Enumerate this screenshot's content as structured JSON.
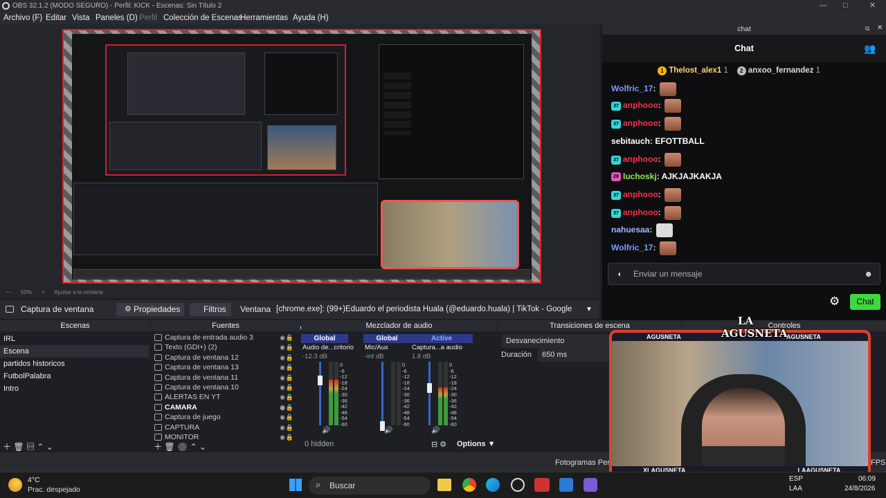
{
  "window": {
    "title": "OBS 32.1.2 (MODO SEGURO) - Perfil: KICK - Escenas: Sin Título 2",
    "controls": [
      "—",
      "□",
      "✕"
    ]
  },
  "menu": [
    "Archivo (F)",
    "Editar",
    "Vista",
    "Paneles (D)",
    "Perfil",
    "Colección de Escenas",
    "Herramientas",
    "Ayuda (H)"
  ],
  "preview": {
    "zoom": "50%",
    "fit_label": "Ajustar a la ventana"
  },
  "context_bar": {
    "source_name": "Captura de ventana",
    "properties": "Propiedades",
    "filters": "Filtros",
    "window_label": "Ventana",
    "window_value": "[chrome.exe]: (99+)Eduardo el periodista Huala (@eduardo.huala) | TikTok - Google Chrome"
  },
  "chat": {
    "dock_title": "chat",
    "header": "Chat",
    "pinned": [
      {
        "rank": "1",
        "user": "Thelost_alex1",
        "count": "1"
      },
      {
        "rank": "2",
        "user": "anxoo_fernandez",
        "count": "1"
      }
    ],
    "messages": [
      {
        "user": "Wolfric_17",
        "badge": "",
        "text": "",
        "color": "#7a9cff",
        "emote": true
      },
      {
        "user": "anphooo",
        "badge": "37",
        "text": "",
        "color": "#ff2a4a",
        "emote": true
      },
      {
        "user": "anphooo",
        "badge": "37",
        "text": "",
        "color": "#ff2a4a",
        "emote": true
      },
      {
        "user": "sebitauch",
        "badge": "",
        "text": "EFOTTBALL",
        "color": "#ffffff",
        "emote": false
      },
      {
        "user": "anphooo",
        "badge": "37",
        "text": "",
        "color": "#ff2a4a",
        "emote": true
      },
      {
        "user": "luchoskj",
        "badge": "28",
        "text": "AJKJAJKAKJA",
        "color": "#9ae64b",
        "emote": false
      },
      {
        "user": "anphooo",
        "badge": "37",
        "text": "",
        "color": "#ff2a4a",
        "emote": true
      },
      {
        "user": "anphooo",
        "badge": "37",
        "text": "",
        "color": "#ff2a4a",
        "emote": true
      },
      {
        "user": "nahuesaa",
        "badge": "",
        "text": "",
        "color": "#9ab8ff",
        "emote": true
      },
      {
        "user": "Wolfric_17",
        "badge": "",
        "text": "",
        "color": "#7a9cff",
        "emote": true
      }
    ],
    "input_placeholder": "Enviar un mensaje",
    "send_label": "Chat"
  },
  "docks": {
    "scenes": {
      "title": "Escenas",
      "items": [
        "IRL",
        "Escena",
        "partidos historicos",
        "FutbolPalabra",
        "Intro"
      ],
      "selected": 1
    },
    "sources": {
      "title": "Fuentes",
      "items": [
        "Captura de entrada audio 3",
        "Texto (GDI+) (2)",
        "Captura de ventana 12",
        "Captura de ventana 13",
        "Captura de ventana 11",
        "Captura de ventana 10",
        "ALERTAS EN YT",
        "CAMARA",
        "Captura de juego",
        "CAPTURA",
        "MONITOR"
      ]
    },
    "mixer": {
      "title": "Mezclador de audio",
      "channels": [
        {
          "tag": "Global",
          "name": "Audio de...critorio",
          "db": "-12.3 dB"
        },
        {
          "tag": "Global",
          "name": "Mic/Aux",
          "db": "-inf dB"
        },
        {
          "tag": "Active",
          "name": "Captura...a audio",
          "db": "1.8 dB"
        }
      ],
      "scale": [
        "0",
        "-6",
        "-12",
        "-18",
        "-24",
        "-30",
        "-36",
        "-42",
        "-48",
        "-54",
        "-60"
      ],
      "hidden": "0 hidden",
      "options": "Options"
    },
    "transitions": {
      "title": "Transiciones de escena",
      "type": "Desvanecimiento",
      "duration_label": "Duración",
      "duration_value": "650 ms"
    },
    "controls": {
      "title": "Controles"
    }
  },
  "status": {
    "frames": "Fotogramas Per",
    "fps": "FPS"
  },
  "overlay": {
    "brand_line1": "LA",
    "brand_line2": "AGUSNETA",
    "handle_ig": "AGUSNETA",
    "handle_yt": "AGUSNETA",
    "handle_x": "XLAGUSNETA",
    "handle_tt": "LAAGUSNETA"
  },
  "taskbar": {
    "weather_temp": "4°C",
    "weather_desc": "Prac. despejado",
    "search": "Buscar",
    "lang": "ESP",
    "lang2": "LAA",
    "time": "06:09",
    "date": "24/8/2026"
  }
}
